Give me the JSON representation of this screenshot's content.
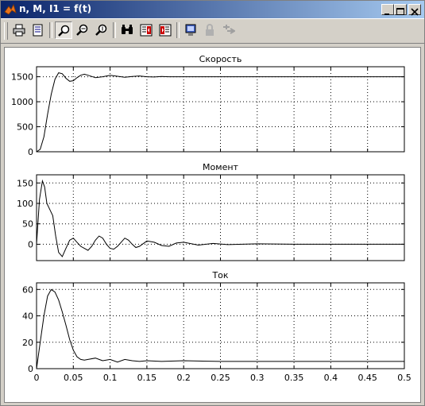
{
  "window": {
    "title": "n, M, I1 = f(t)"
  },
  "toolbar": {
    "tools": [
      "print-icon",
      "print-preview-icon",
      "zoom-icon",
      "zoom-in-icon",
      "zoom-out-icon",
      "binoculars-icon",
      "restore-config-icon",
      "save-config-icon",
      "floating-scope-icon",
      "lock-axes-icon",
      "signal-selection-icon"
    ]
  },
  "colors": {
    "titlebar_start": "#0a246a",
    "titlebar_end": "#a6caf0",
    "chrome": "#d4d0c8",
    "plot_line": "#000000"
  },
  "chart_data": [
    {
      "type": "line",
      "title": "Скорость",
      "xlim": [
        0,
        0.5
      ],
      "ylim": [
        0,
        1700
      ],
      "yticks": [
        0,
        500,
        1000,
        1500
      ],
      "yticklabels": [
        "0",
        "500",
        "1000",
        "1500"
      ],
      "grid": true,
      "series": [
        {
          "x": [
            0,
            0.005,
            0.01,
            0.015,
            0.02,
            0.025,
            0.03,
            0.035,
            0.04,
            0.045,
            0.05,
            0.055,
            0.06,
            0.065,
            0.07,
            0.08,
            0.09,
            0.1,
            0.11,
            0.12,
            0.13,
            0.14,
            0.15,
            0.16,
            0.17,
            0.18,
            0.2,
            0.25,
            0.3,
            0.35,
            0.4,
            0.45,
            0.5
          ],
          "y": [
            0,
            50,
            300,
            750,
            1150,
            1450,
            1580,
            1560,
            1470,
            1410,
            1420,
            1480,
            1530,
            1550,
            1530,
            1480,
            1500,
            1530,
            1510,
            1490,
            1505,
            1515,
            1500,
            1495,
            1505,
            1500,
            1500,
            1500,
            1500,
            1500,
            1500,
            1500,
            1500
          ]
        }
      ]
    },
    {
      "type": "line",
      "title": "Момент",
      "xlim": [
        0,
        0.5
      ],
      "ylim": [
        -40,
        170
      ],
      "yticks": [
        0,
        50,
        100,
        150
      ],
      "yticklabels": [
        "0",
        "50",
        "100",
        "150"
      ],
      "grid": true,
      "series": [
        {
          "x": [
            0,
            0.004,
            0.008,
            0.011,
            0.014,
            0.018,
            0.022,
            0.026,
            0.03,
            0.035,
            0.04,
            0.045,
            0.05,
            0.055,
            0.06,
            0.065,
            0.07,
            0.075,
            0.08,
            0.085,
            0.09,
            0.095,
            0.1,
            0.105,
            0.11,
            0.115,
            0.12,
            0.125,
            0.13,
            0.135,
            0.14,
            0.15,
            0.16,
            0.17,
            0.18,
            0.19,
            0.2,
            0.22,
            0.24,
            0.26,
            0.28,
            0.3,
            0.35,
            0.4,
            0.45,
            0.5
          ],
          "y": [
            0,
            110,
            155,
            140,
            100,
            85,
            70,
            20,
            -20,
            -30,
            -10,
            10,
            15,
            5,
            -5,
            -10,
            -15,
            -5,
            10,
            20,
            15,
            0,
            -10,
            -12,
            -5,
            5,
            15,
            10,
            0,
            -8,
            -5,
            8,
            5,
            -3,
            -5,
            3,
            5,
            -2,
            2,
            -1,
            0,
            1,
            0,
            0,
            0,
            0
          ]
        }
      ]
    },
    {
      "type": "line",
      "title": "Ток",
      "xlim": [
        0,
        0.5
      ],
      "ylim": [
        0,
        65
      ],
      "yticks": [
        0,
        20,
        40,
        60
      ],
      "yticklabels": [
        "0",
        "20",
        "40",
        "60"
      ],
      "xticks": [
        0,
        0.05,
        0.1,
        0.15,
        0.2,
        0.25,
        0.3,
        0.35,
        0.4,
        0.45,
        0.5
      ],
      "xticklabels": [
        "0",
        "0.05",
        "0.1",
        "0.15",
        "0.2",
        "0.25",
        "0.3",
        "0.35",
        "0.4",
        "0.45",
        "0.5"
      ],
      "grid": true,
      "series": [
        {
          "x": [
            0,
            0.005,
            0.01,
            0.015,
            0.02,
            0.025,
            0.03,
            0.035,
            0.04,
            0.045,
            0.05,
            0.055,
            0.06,
            0.065,
            0.07,
            0.08,
            0.09,
            0.1,
            0.11,
            0.12,
            0.13,
            0.14,
            0.15,
            0.17,
            0.2,
            0.25,
            0.3,
            0.4,
            0.5
          ],
          "y": [
            0,
            20,
            40,
            55,
            60,
            58,
            52,
            43,
            33,
            22,
            14,
            9,
            7,
            6.5,
            7,
            8,
            6,
            7,
            5,
            7,
            6,
            5.5,
            6,
            5.5,
            6,
            5.5,
            5.5,
            5.5,
            5.5
          ]
        }
      ]
    }
  ]
}
